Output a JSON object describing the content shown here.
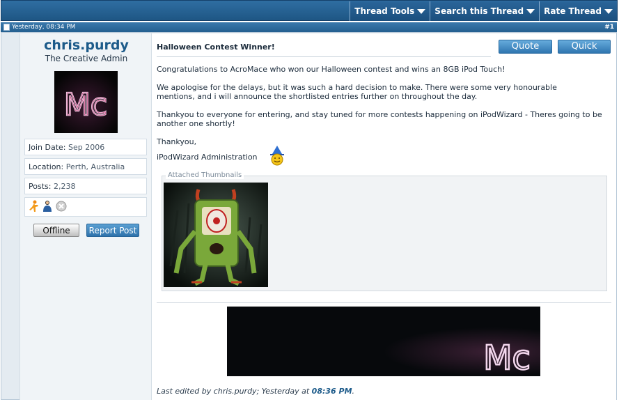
{
  "thread_tools": {
    "items": [
      {
        "label": "Thread Tools"
      },
      {
        "label": "Search this Thread"
      },
      {
        "label": "Rate Thread"
      }
    ]
  },
  "post_header": {
    "date": "Yesterday, 08:34 PM",
    "post_number": "#1"
  },
  "user": {
    "name": "chris.purdy",
    "title": "The Creative Admin",
    "avatar_text": "Mc",
    "join_date_label": "Join Date:",
    "join_date": "Sep 2006",
    "location_label": "Location:",
    "location": "Perth, Australia",
    "posts_label": "Posts:",
    "posts": "2,238",
    "status_label": "Offline",
    "report_label": "Report Post"
  },
  "post": {
    "title": "Halloween Contest Winner!",
    "quote_label": "Quote",
    "quick_reply_label": "Quick Reply",
    "paragraphs": [
      "Congratulations to AcroMace who won our Halloween contest and wins an 8GB iPod Touch!",
      "We apologise for the delays, but it was such a hard decision to make. There were some very honourable mentions, and i will announce the shortlisted entries further on throughout the day.",
      "Thankyou to everyone for entering, and stay tuned for more contests happening on iPodWizard - Theres going to be another one shortly!",
      "Thankyou,",
      "iPodWizard Administration"
    ],
    "attachments_legend": "Attached Thumbnails",
    "signature_text": "Mc",
    "edited_prefix": "Last edited by chris.purdy; Yesterday at",
    "edited_time": "08:36 PM",
    "edited_suffix": "."
  },
  "colors": {
    "header_blue": "#1e5684",
    "username_blue": "#1d5b8a",
    "button_blue": "#2f76b0"
  }
}
